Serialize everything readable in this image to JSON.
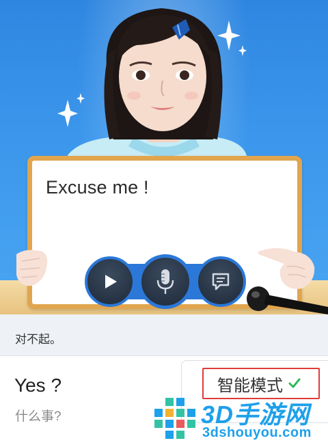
{
  "lesson": {
    "prompt_text": "Excuse me !",
    "translation": "对不起。"
  },
  "controls": {
    "play_icon": "play-icon",
    "mic_icon": "microphone-icon",
    "chat_icon": "chat-bubble-icon"
  },
  "reply": {
    "english": "Yes ?",
    "chinese": "什么事?"
  },
  "mode": {
    "label": "智能模式",
    "icon": "checkmark-icon",
    "check_color": "#2fb85a",
    "highlight_color": "#e03a3a"
  },
  "watermark": {
    "title": "3D手游网",
    "subtitle": "3dshouyou.com"
  },
  "colors": {
    "stage_blue": "#3c97ec",
    "board_frame": "#e1a54e",
    "control_ring": "#2b78d8"
  }
}
